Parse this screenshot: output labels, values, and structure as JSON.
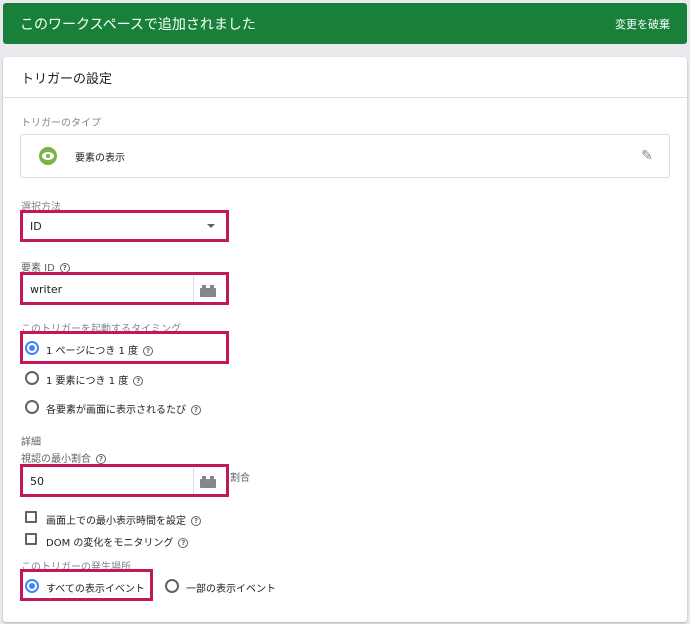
{
  "banner": {
    "title": "このワークスペースで追加されました",
    "discard_label": "変更を破棄",
    "color": "#188038"
  },
  "card": {
    "title": "トリガーの設定"
  },
  "trigger_type": {
    "label": "トリガーのタイプ",
    "value": "要素の表示",
    "icon": "eye-icon",
    "edit_icon": "pencil-icon"
  },
  "selection": {
    "label": "選択方法",
    "value": "ID"
  },
  "element_id": {
    "label": "要素 ID",
    "value": "writer"
  },
  "timing": {
    "label": "このトリガーを起動するタイミング",
    "options": [
      {
        "label": "1 ページにつき 1 度",
        "selected": true
      },
      {
        "label": "1 要素につき 1 度",
        "selected": false
      },
      {
        "label": "各要素が画面に表示されるたび",
        "selected": false
      }
    ]
  },
  "details": {
    "label": "詳細",
    "min_ratio_label": "視認の最小割合",
    "min_ratio_value": "50",
    "min_ratio_suffix": "割合",
    "checkboxes": [
      {
        "label": "画面上での最小表示時間を設定",
        "checked": false
      },
      {
        "label": "DOM の変化をモニタリング",
        "checked": false
      }
    ]
  },
  "fire_on": {
    "label": "このトリガーの発生場所",
    "options": [
      {
        "label": "すべての表示イベント",
        "selected": true
      },
      {
        "label": "一部の表示イベント",
        "selected": false
      }
    ]
  },
  "colors": {
    "highlight": "#c2185b",
    "accent": "#4285f4"
  }
}
